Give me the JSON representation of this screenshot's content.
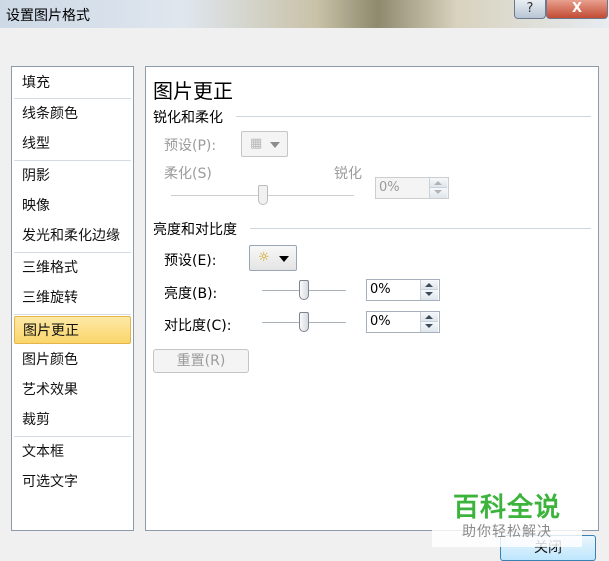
{
  "window": {
    "title": "设置图片格式",
    "help_label": "?",
    "close_label": "X"
  },
  "sidebar": {
    "items": [
      {
        "label": "填充"
      },
      {
        "label": "线条颜色"
      },
      {
        "label": "线型"
      },
      {
        "label": "阴影"
      },
      {
        "label": "映像"
      },
      {
        "label": "发光和柔化边缘"
      },
      {
        "label": "三维格式"
      },
      {
        "label": "三维旋转"
      },
      {
        "label": "图片更正"
      },
      {
        "label": "图片颜色"
      },
      {
        "label": "艺术效果"
      },
      {
        "label": "裁剪"
      },
      {
        "label": "文本框"
      },
      {
        "label": "可选文字"
      }
    ],
    "selected": "图片更正"
  },
  "panel": {
    "title": "图片更正",
    "sharpen_section": {
      "heading": "锐化和柔化",
      "preset_label": "预设(P):",
      "soften_label": "柔化(S)",
      "sharpen_label": "锐化",
      "value": "0%",
      "slider_fraction": 0.5
    },
    "brightness_section": {
      "heading": "亮度和对比度",
      "preset_label": "预设(E):",
      "brightness_label": "亮度(B):",
      "brightness_value": "0%",
      "brightness_fraction": 0.5,
      "contrast_label": "对比度(C):",
      "contrast_value": "0%",
      "contrast_fraction": 0.5
    },
    "reset_label": "重置(R)"
  },
  "footer": {
    "close_label": "关闭"
  },
  "watermark": {
    "main": "百科全说",
    "sub": "助你轻松解决"
  },
  "colors": {
    "selected_item": "#fad56a",
    "watermark_green": "#3cb43c"
  }
}
